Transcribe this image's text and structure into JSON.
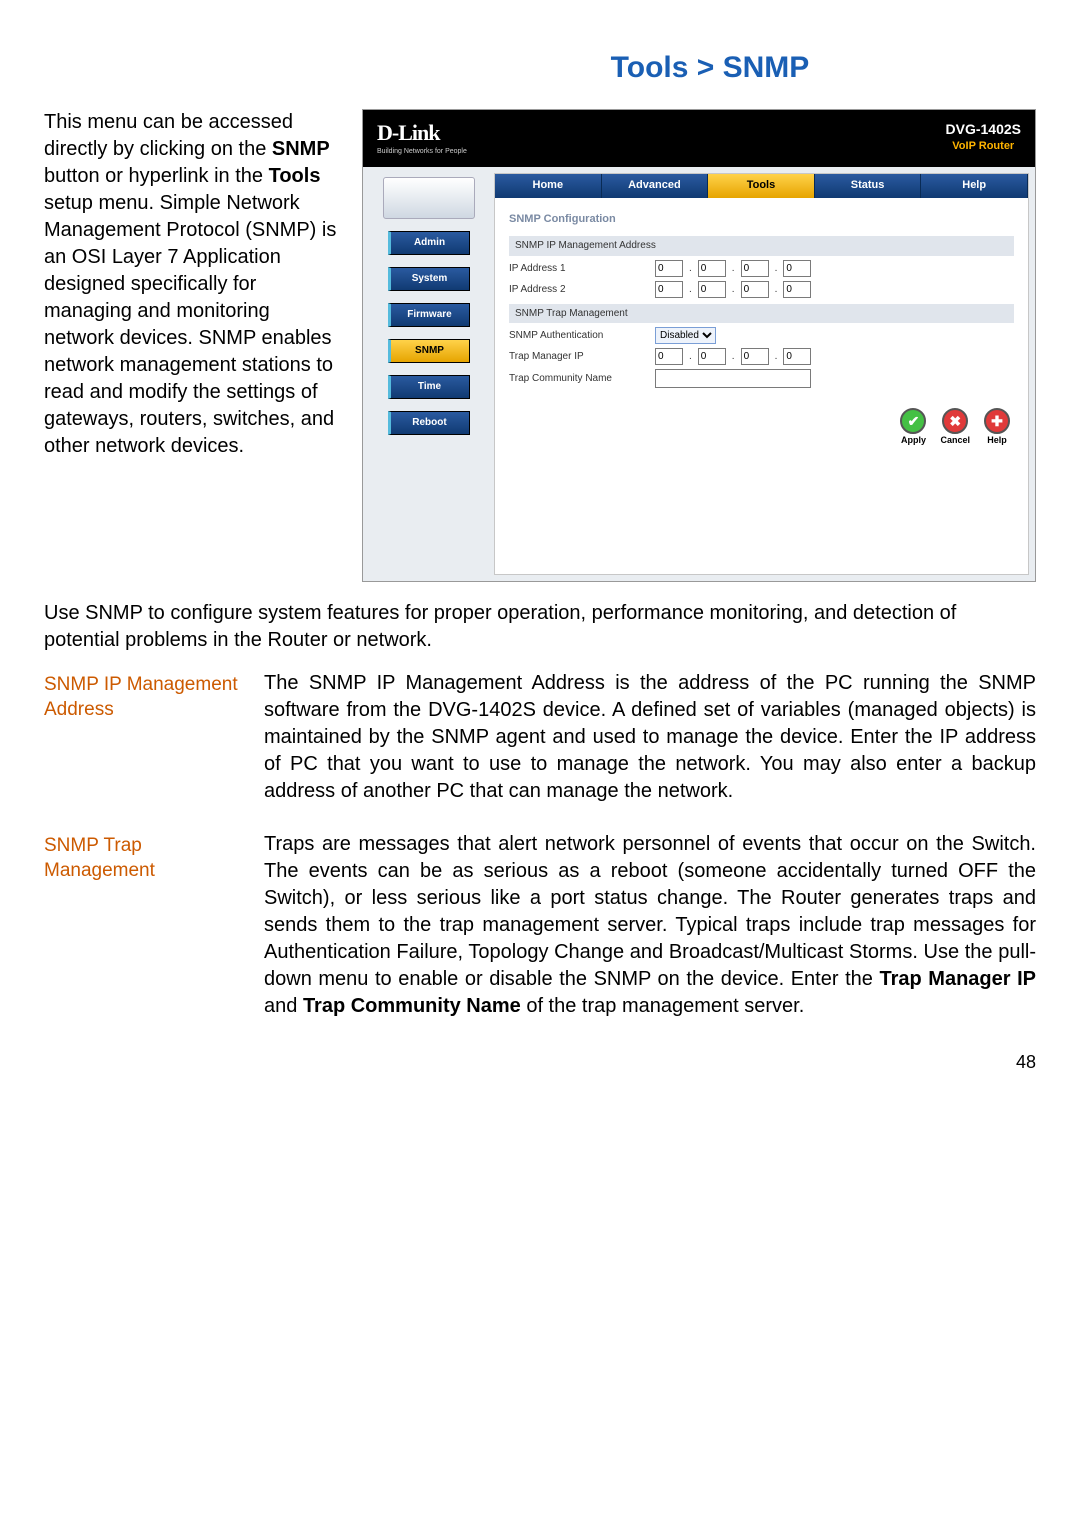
{
  "page_title": "Tools > SNMP",
  "intro": {
    "part1": "This menu can be accessed directly by clicking on the ",
    "bold1": "SNMP",
    "part2": " button or hyperlink in the ",
    "bold2": "Tools",
    "part3": " setup menu. Simple Network Management Protocol (SNMP) is an OSI Layer 7 Application designed specifically for managing and monitoring network devices. SNMP enables network management stations to read and modify the settings of gateways, routers, switches, and other network devices."
  },
  "router": {
    "logo_big": "D-Link",
    "logo_small": "Building Networks for People",
    "model": "DVG-1402S",
    "model_sub": "VoIP Router",
    "side_buttons": [
      "Admin",
      "System",
      "Firmware",
      "SNMP",
      "Time",
      "Reboot"
    ],
    "side_active_index": 3,
    "tabs": [
      "Home",
      "Advanced",
      "Tools",
      "Status",
      "Help"
    ],
    "tab_active_index": 2,
    "section_title": "SNMP Configuration",
    "subhead1": "SNMP IP Management Address",
    "ip1_label": "IP Address 1",
    "ip2_label": "IP Address 2",
    "subhead2": "SNMP Trap Management",
    "auth_label": "SNMP Authentication",
    "auth_value": "Disabled",
    "trap_ip_label": "Trap Manager IP",
    "trap_name_label": "Trap Community Name",
    "ip_octet": "0",
    "actions": {
      "apply": "Apply",
      "cancel": "Cancel",
      "help": "Help"
    }
  },
  "mid_paragraph": "Use SNMP to configure system features for proper operation, performance monitoring, and detection of potential problems in the Router or network.",
  "defs": [
    {
      "term": "SNMP IP Management Address",
      "body": "The SNMP IP Management Address is the address of the PC running the SNMP software from the DVG-1402S device. A defined set of variables (managed objects) is maintained by the SNMP agent and used to manage the device. Enter the IP address of PC that you want to use to manage the network. You may also enter a backup address of another PC that can manage the network."
    },
    {
      "term": "SNMP Trap Management",
      "body_pre": "Traps are messages that alert network personnel of events that occur on the Switch. The events can be as serious as a reboot (someone accidentally turned OFF the Switch), or less serious like a port status change. The Router generates traps and sends them to the trap management server. Typical traps include trap messages for Authentication Failure, Topology Change and Broadcast/Multicast Storms. Use the pull-down menu to enable or disable the SNMP on the device. Enter the ",
      "bold1": "Trap Manager IP",
      "mid": " and ",
      "bold2": "Trap Community Name",
      "body_post": " of the trap management server."
    }
  ],
  "page_number": "48"
}
